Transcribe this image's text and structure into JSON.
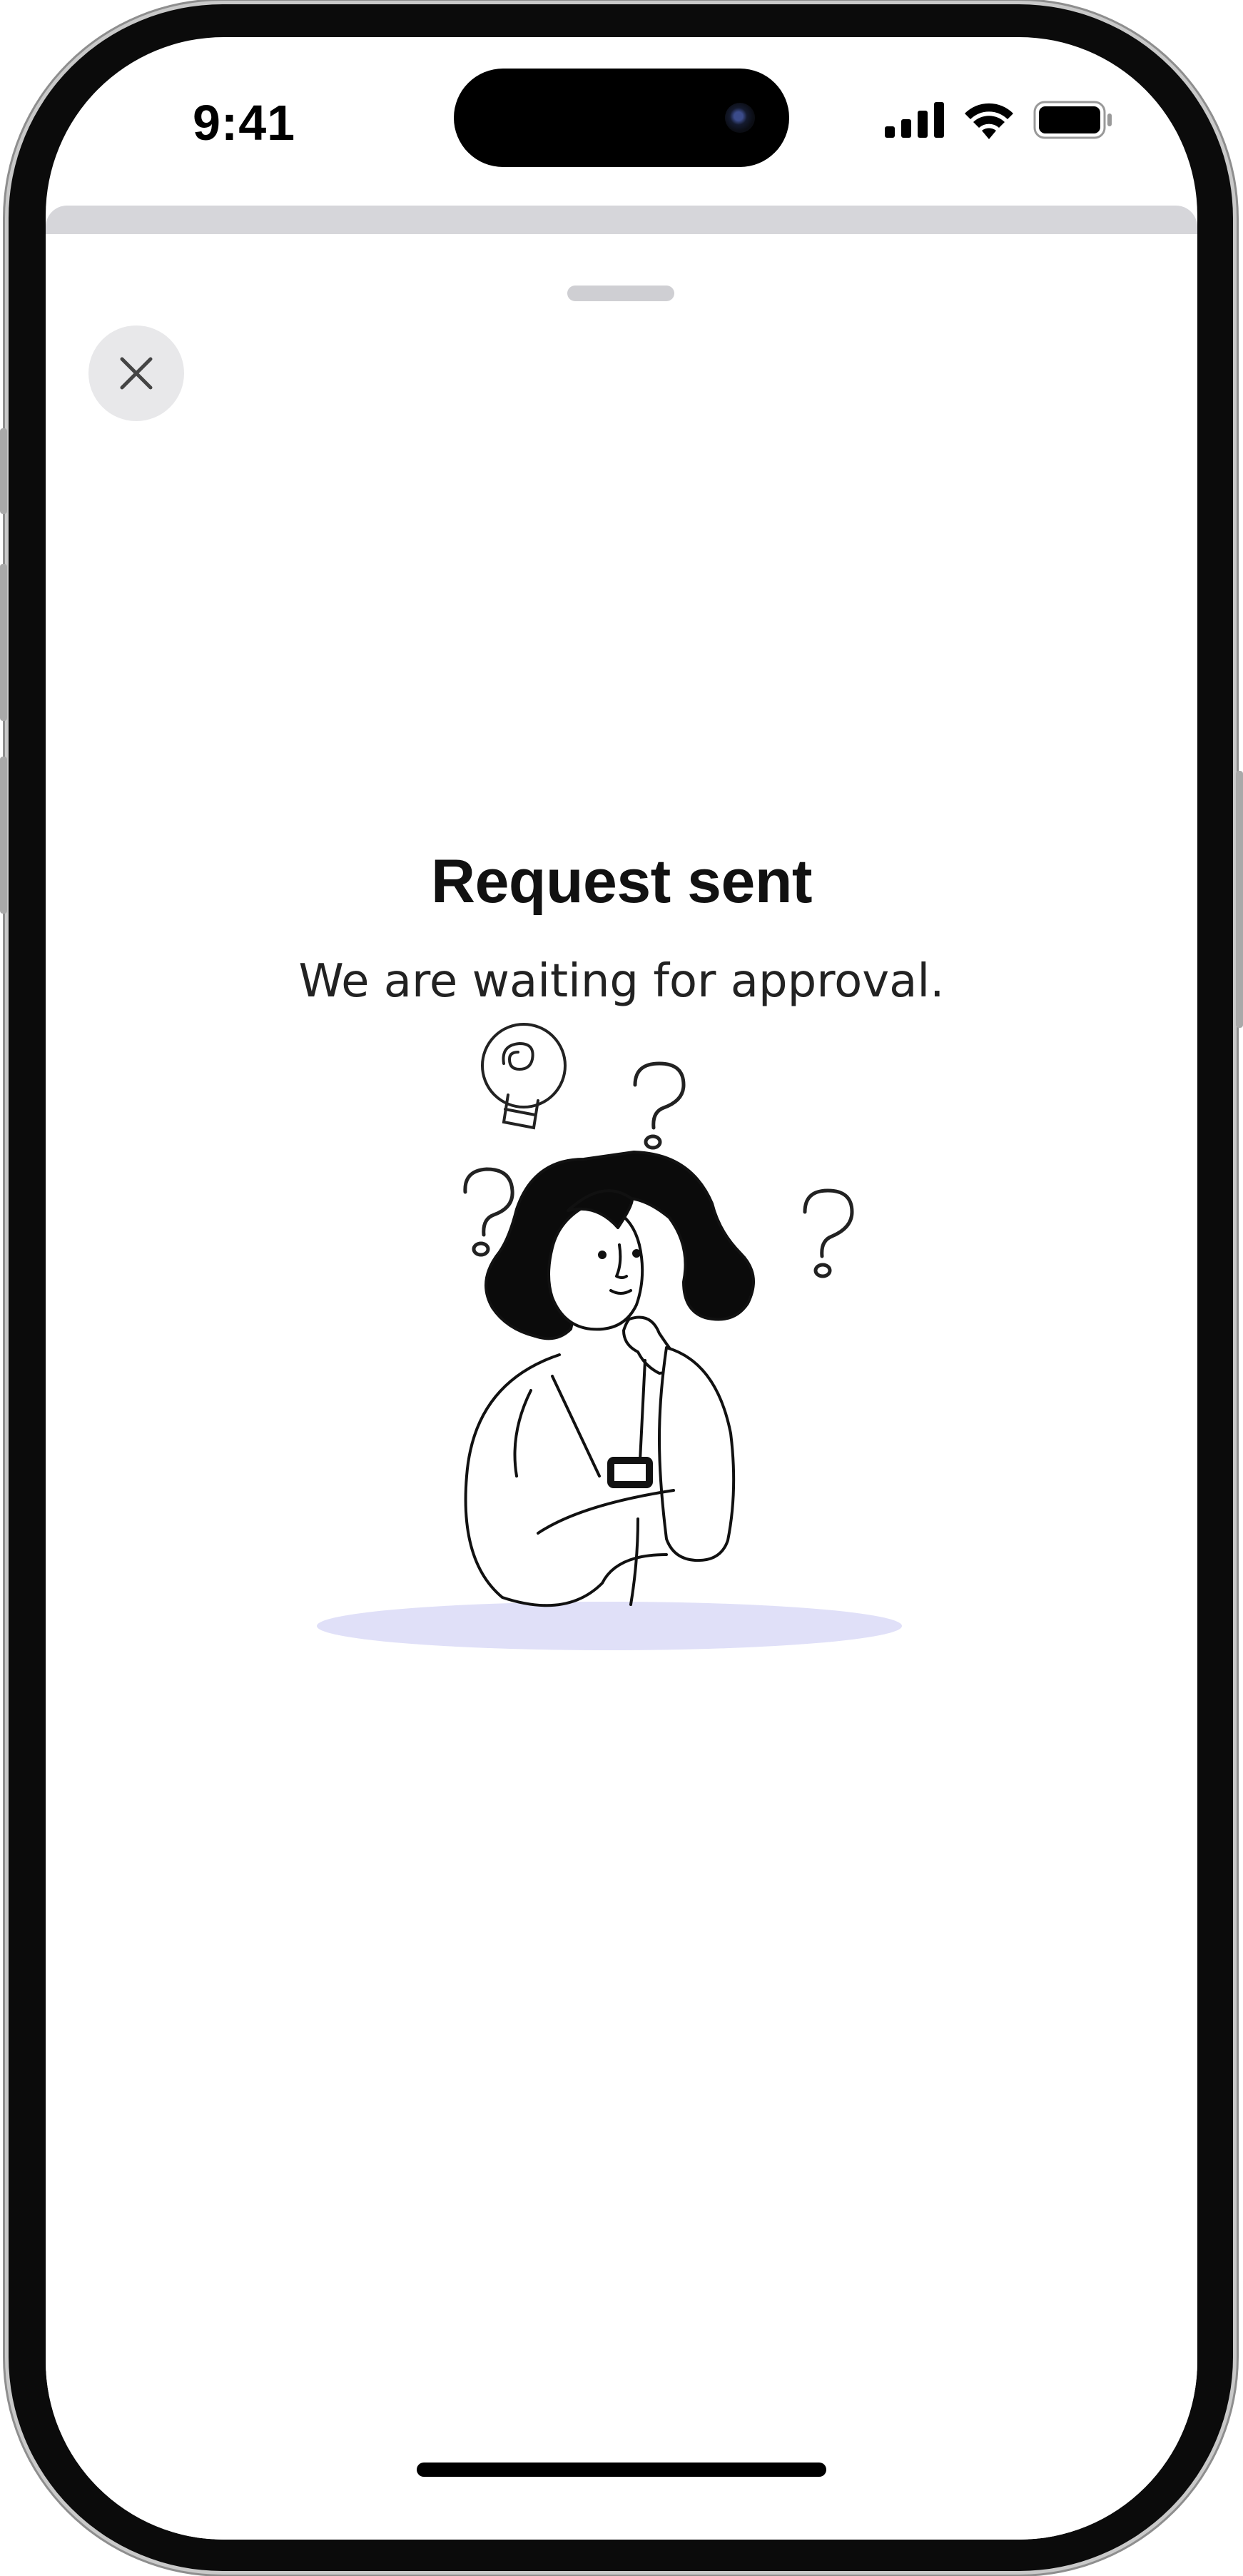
{
  "status_bar": {
    "time": "9:41"
  },
  "sheet": {
    "close_icon": "close-icon",
    "title": "Request sent",
    "subtitle": "We are waiting for approval."
  },
  "colors": {
    "accent_shadow": "#e0e0f8",
    "close_bg": "#e8e8ea",
    "text_primary": "#111111"
  }
}
